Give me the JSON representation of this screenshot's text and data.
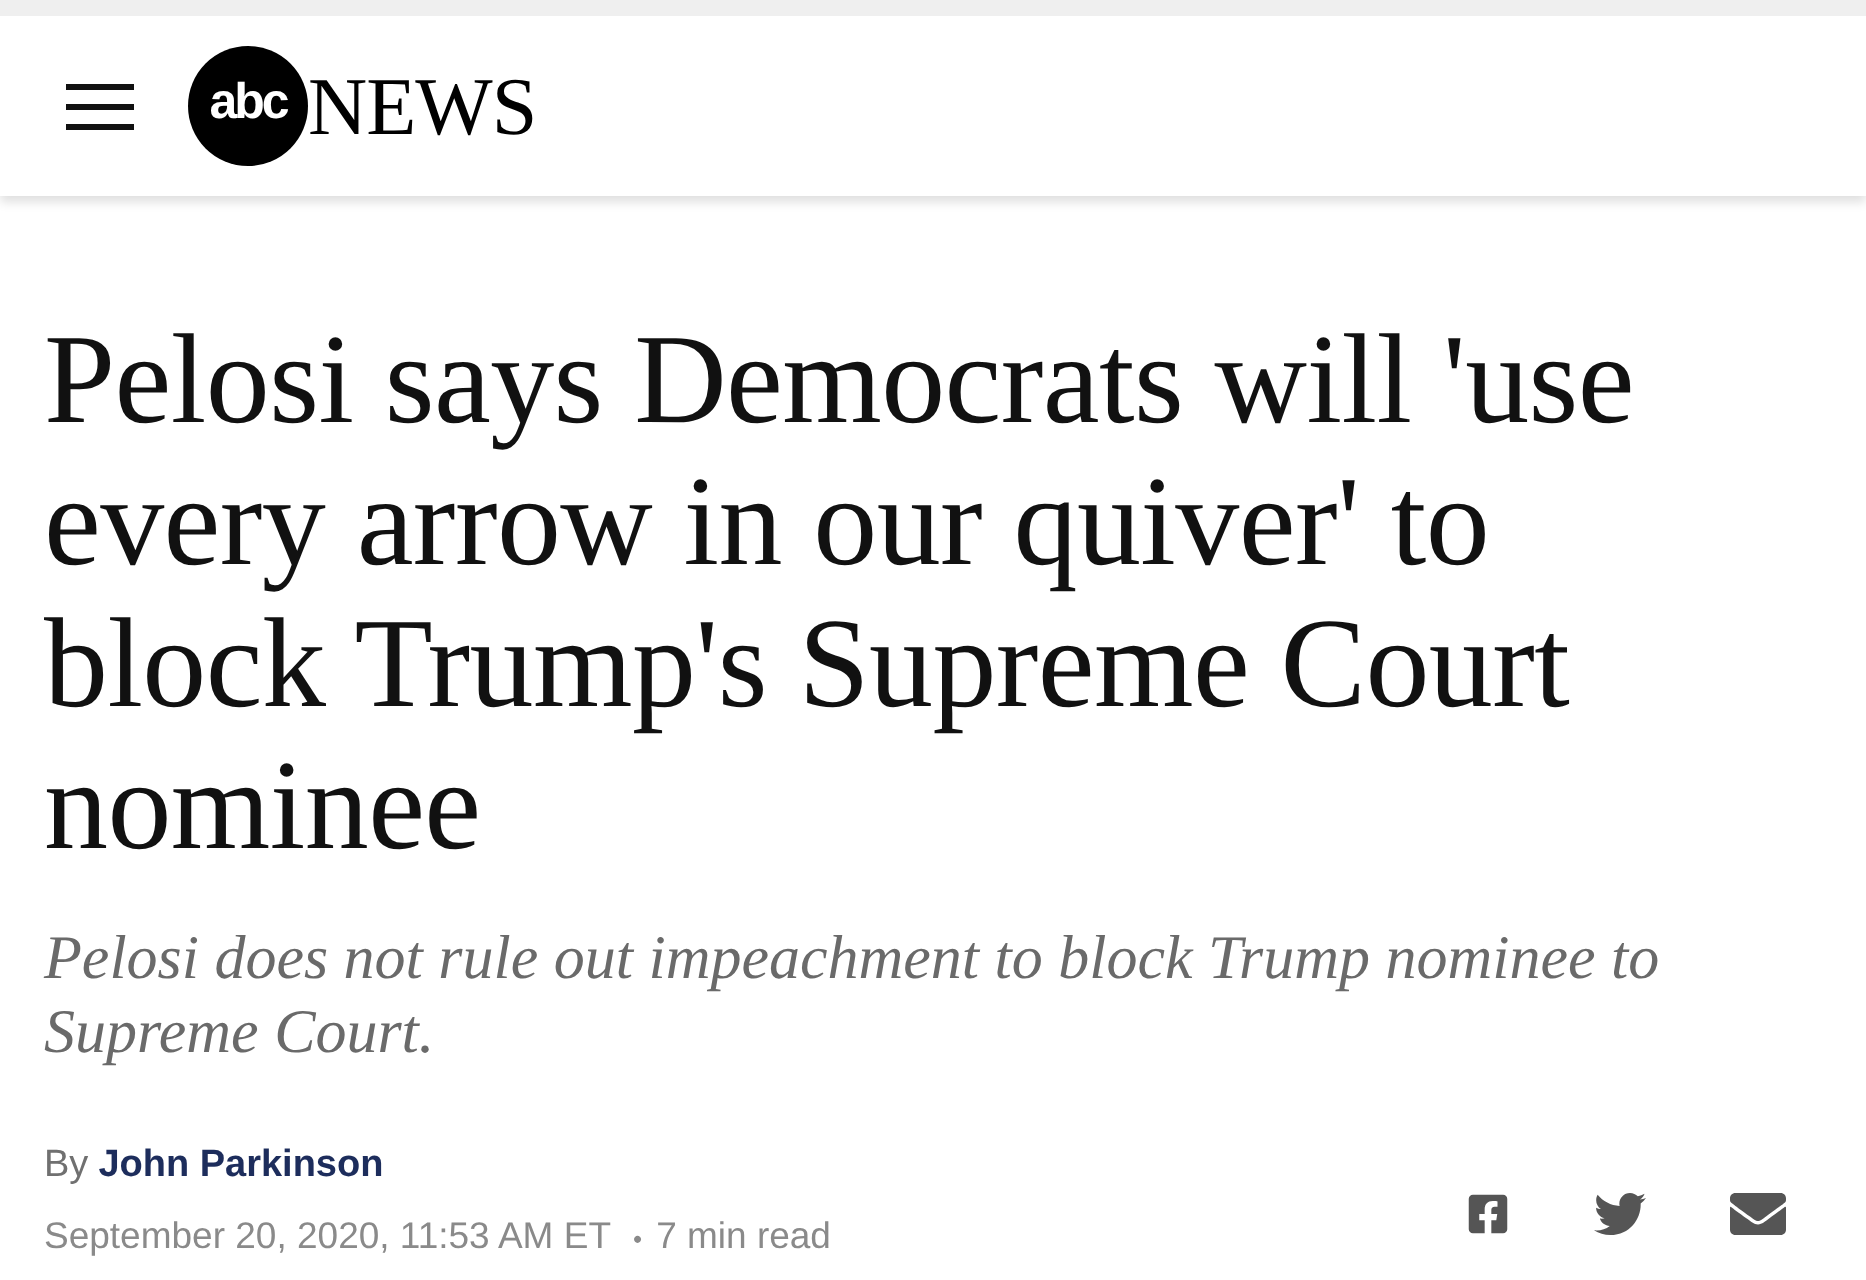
{
  "header": {
    "logo": {
      "mark": "abc",
      "wordmark": "NEWS"
    }
  },
  "article": {
    "headline": "Pelosi says Democrats will 'use every arrow in our quiver' to block Trump's Supreme Court nominee",
    "subheadline": "Pelosi does not rule out impeachment to block Trump nominee to Supreme Court.",
    "byline": {
      "prefix": "By",
      "author": "John Parkinson"
    },
    "date": "September 20, 2020, 11:53 AM ET",
    "separator": "•",
    "read_time": "7 min read"
  }
}
